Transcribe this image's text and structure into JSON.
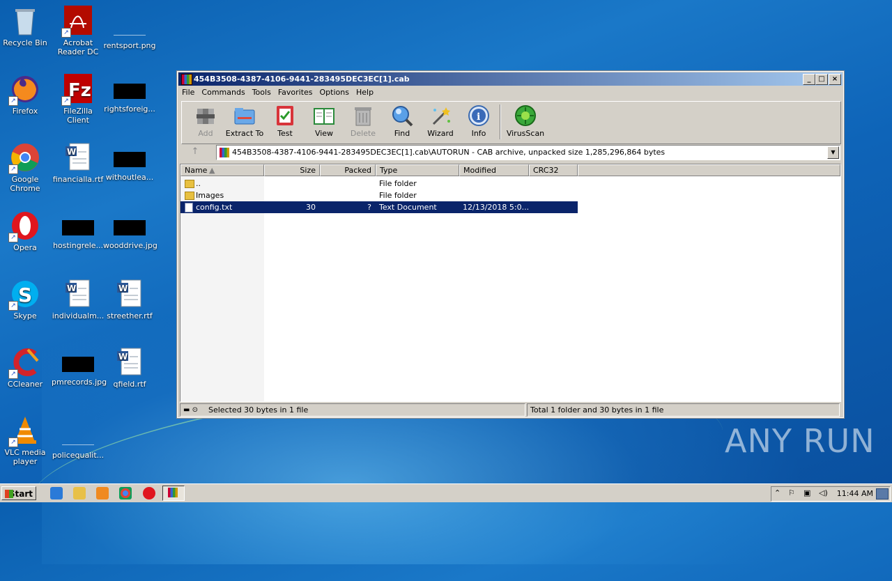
{
  "desktop": {
    "icons": [
      {
        "label": "Recycle Bin"
      },
      {
        "label": "Acrobat Reader DC"
      },
      {
        "label": "rentsport.png"
      },
      {
        "label": "Firefox"
      },
      {
        "label": "FileZilla Client"
      },
      {
        "label": "rightsforeig..."
      },
      {
        "label": "Google Chrome"
      },
      {
        "label": "financialla.rtf"
      },
      {
        "label": "withoutlea..."
      },
      {
        "label": "Opera"
      },
      {
        "label": "hostingrele..."
      },
      {
        "label": "wooddrive.jpg"
      },
      {
        "label": "Skype"
      },
      {
        "label": "individualm..."
      },
      {
        "label": "streether.rtf"
      },
      {
        "label": "CCleaner"
      },
      {
        "label": "pmrecords.jpg"
      },
      {
        "label": "qfield.rtf"
      },
      {
        "label": "VLC media player"
      },
      {
        "label": "policequalit..."
      }
    ]
  },
  "window": {
    "title": "454B3508-4387-4106-9441-283495DEC3EC[1].cab",
    "menu": [
      "File",
      "Commands",
      "Tools",
      "Favorites",
      "Options",
      "Help"
    ],
    "toolbar": [
      {
        "label": "Add",
        "icon": "add-icon",
        "enabled": false
      },
      {
        "label": "Extract To",
        "icon": "extract-icon",
        "enabled": true
      },
      {
        "label": "Test",
        "icon": "test-icon",
        "enabled": true
      },
      {
        "label": "View",
        "icon": "view-icon",
        "enabled": true
      },
      {
        "label": "Delete",
        "icon": "delete-icon",
        "enabled": false
      },
      {
        "label": "Find",
        "icon": "find-icon",
        "enabled": true
      },
      {
        "label": "Wizard",
        "icon": "wizard-icon",
        "enabled": true
      },
      {
        "label": "Info",
        "icon": "info-icon",
        "enabled": true
      },
      {
        "label": "VirusScan",
        "icon": "virusscan-icon",
        "enabled": true
      }
    ],
    "address": "454B3508-4387-4106-9441-283495DEC3EC[1].cab\\AUTORUN - CAB archive, unpacked size 1,285,296,864 bytes",
    "columns": [
      "Name",
      "Size",
      "Packed",
      "Type",
      "Modified",
      "CRC32"
    ],
    "rows": [
      {
        "name": "..",
        "size": "",
        "packed": "",
        "type": "File folder",
        "modified": "",
        "crc": "",
        "kind": "folder",
        "selected": false
      },
      {
        "name": "Images",
        "size": "",
        "packed": "",
        "type": "File folder",
        "modified": "",
        "crc": "",
        "kind": "folder",
        "selected": false
      },
      {
        "name": "config.txt",
        "size": "30",
        "packed": "?",
        "type": "Text Document",
        "modified": "12/13/2018 5:0...",
        "crc": "",
        "kind": "file",
        "selected": true
      }
    ],
    "status_left": "Selected 30 bytes in 1 file",
    "status_right": "Total 1 folder and 30 bytes in 1 file"
  },
  "taskbar": {
    "start_label": "Start",
    "clock": "11:44 AM"
  },
  "watermark": "ANY RUN"
}
